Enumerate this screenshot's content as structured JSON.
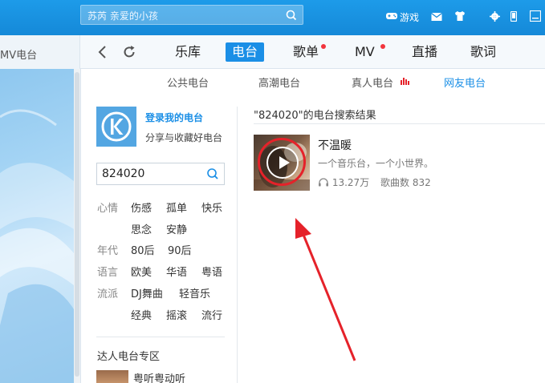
{
  "search": {
    "text": "苏芮 亲爱的小孩"
  },
  "top_icons": {
    "game_label": "游戏",
    "icons": [
      "gamepad-icon",
      "mail-icon",
      "shirt-icon",
      "gear-icon",
      "mobile-icon",
      "minimize-icon"
    ]
  },
  "left_tab": {
    "label": "MV电台"
  },
  "nav": {
    "items": [
      {
        "label": "乐库"
      },
      {
        "label": "电台"
      },
      {
        "label": "歌单"
      },
      {
        "label": "MV"
      },
      {
        "label": "直播"
      },
      {
        "label": "歌词"
      }
    ],
    "active_index": 1
  },
  "subtabs": [
    {
      "label": "公共电台"
    },
    {
      "label": "高潮电台"
    },
    {
      "label": "真人电台"
    },
    {
      "label": "网友电台"
    }
  ],
  "sidebar": {
    "login_link": "登录我的电台",
    "login_sub": "分享与收藏好电台",
    "search_value": "824020",
    "categories": [
      {
        "label": "心情",
        "tags": [
          "伤感",
          "孤单",
          "快乐",
          "思念",
          "安静"
        ]
      },
      {
        "label": "年代",
        "tags": [
          "80后",
          "90后"
        ]
      },
      {
        "label": "语言",
        "tags": [
          "欧美",
          "华语",
          "粤语"
        ]
      },
      {
        "label": "流派",
        "tags": [
          "DJ舞曲",
          "轻音乐",
          "经典",
          "摇滚",
          "流行"
        ]
      }
    ],
    "expert_title": "达人电台专区",
    "expert_first": "粤听粤动听"
  },
  "results": {
    "title": "\"824020\"的电台搜索结果",
    "items": [
      {
        "name": "不温暖",
        "desc": "一个音乐台，一个小世界。",
        "listeners": "13.27万",
        "song_count_label": "歌曲数",
        "song_count": "832"
      }
    ]
  },
  "colors": {
    "accent": "#1b8fe6",
    "topbar": "#1589d8",
    "annotation": "#e5222a"
  }
}
